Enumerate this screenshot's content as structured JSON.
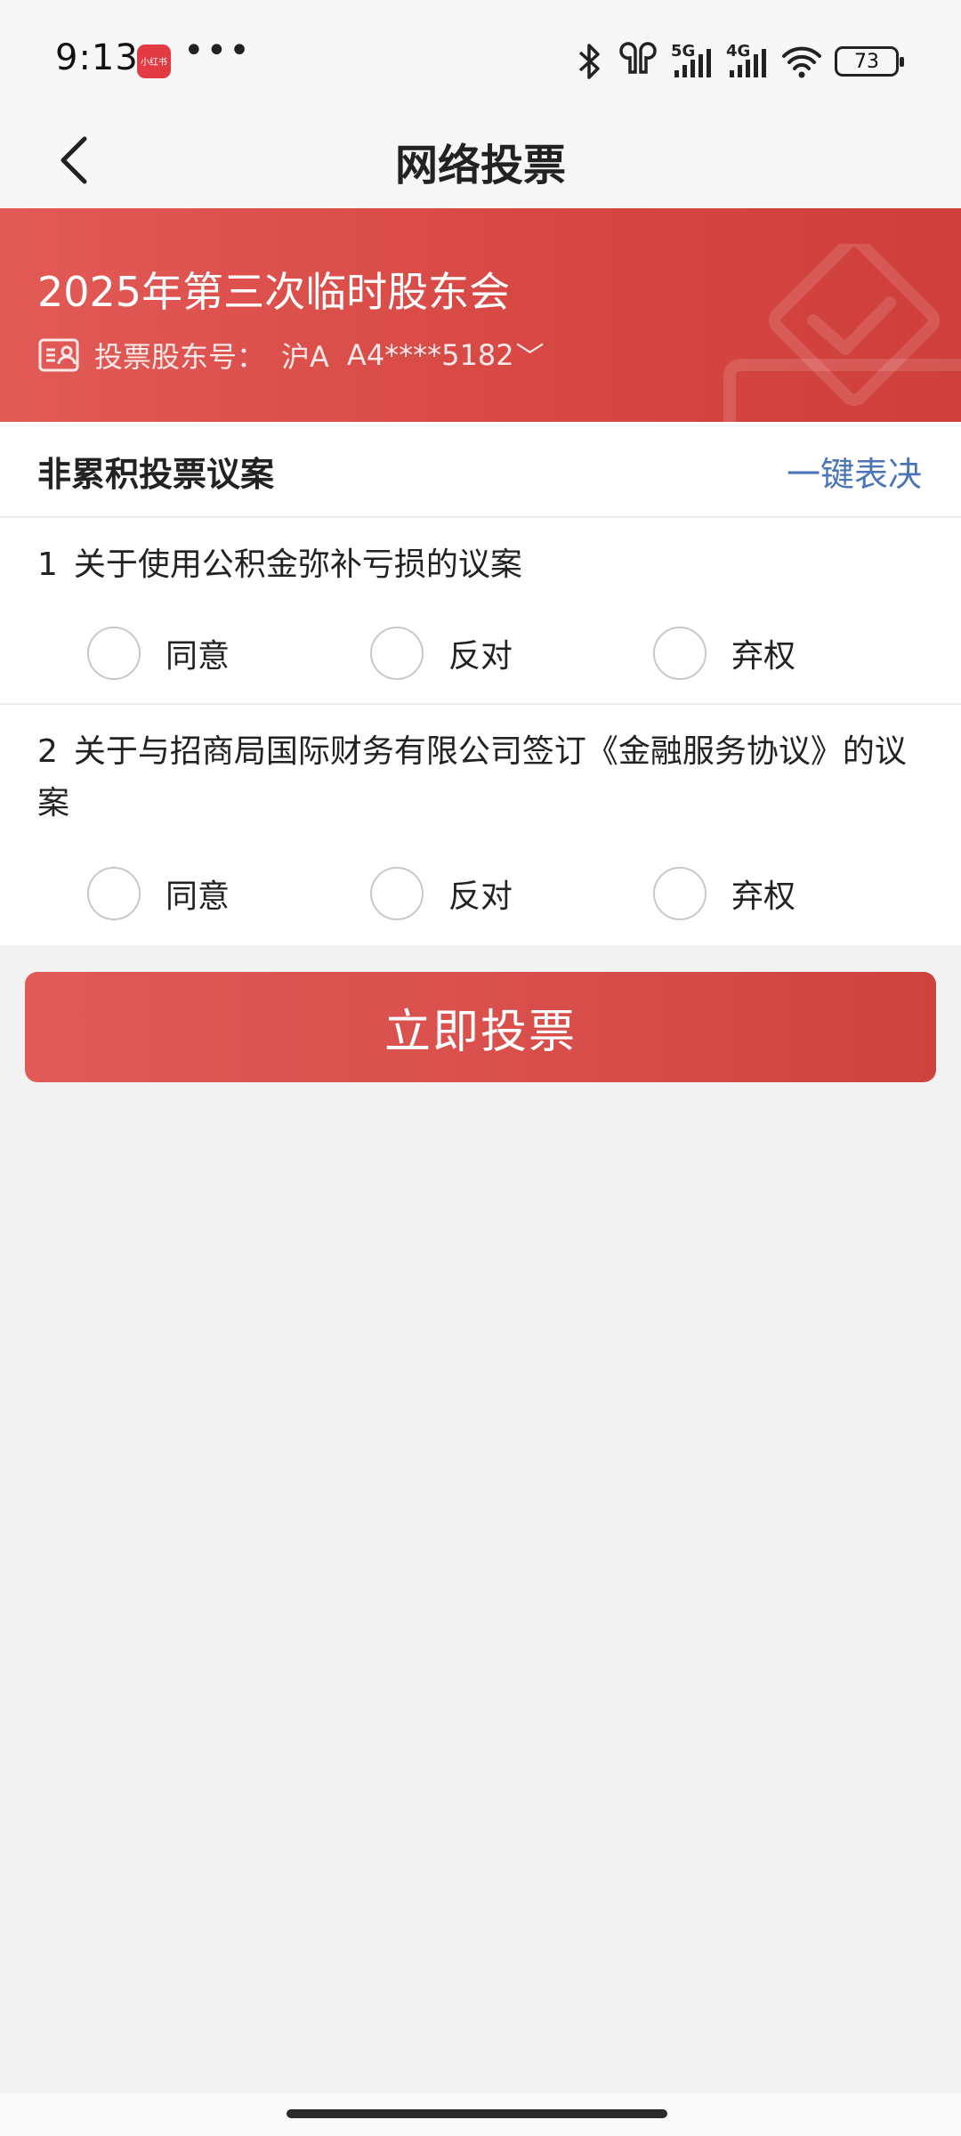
{
  "status_bar": {
    "time": "9:13",
    "app_badge": "小红书",
    "more_dots": "•••",
    "network_1": "5G",
    "network_2": "4G",
    "battery": "73",
    "icons": [
      "bluetooth-icon",
      "earbuds-icon",
      "signal-5g-icon",
      "signal-4g-icon",
      "wifi-icon",
      "battery-icon"
    ]
  },
  "nav": {
    "title": "网络投票",
    "back_icon": "chevron-left-icon"
  },
  "banner": {
    "title": "2025年第三次临时股东会",
    "holder_label": "投票股东号：",
    "holder_prefix": "沪A",
    "holder_number": "A4****5182",
    "chevron": "﹀",
    "accent_color": "#d74844"
  },
  "section": {
    "title": "非累积投票议案",
    "action": "一键表决",
    "action_color": "#4a76b8"
  },
  "proposals": [
    {
      "number": "1",
      "text": "关于使用公积金弥补亏损的议案",
      "options": [
        "同意",
        "反对",
        "弃权"
      ]
    },
    {
      "number": "2",
      "text": "关于与招商局国际财务有限公司签订《金融服务协议》的议案",
      "options": [
        "同意",
        "反对",
        "弃权"
      ]
    }
  ],
  "submit": {
    "label": "立即投票"
  }
}
